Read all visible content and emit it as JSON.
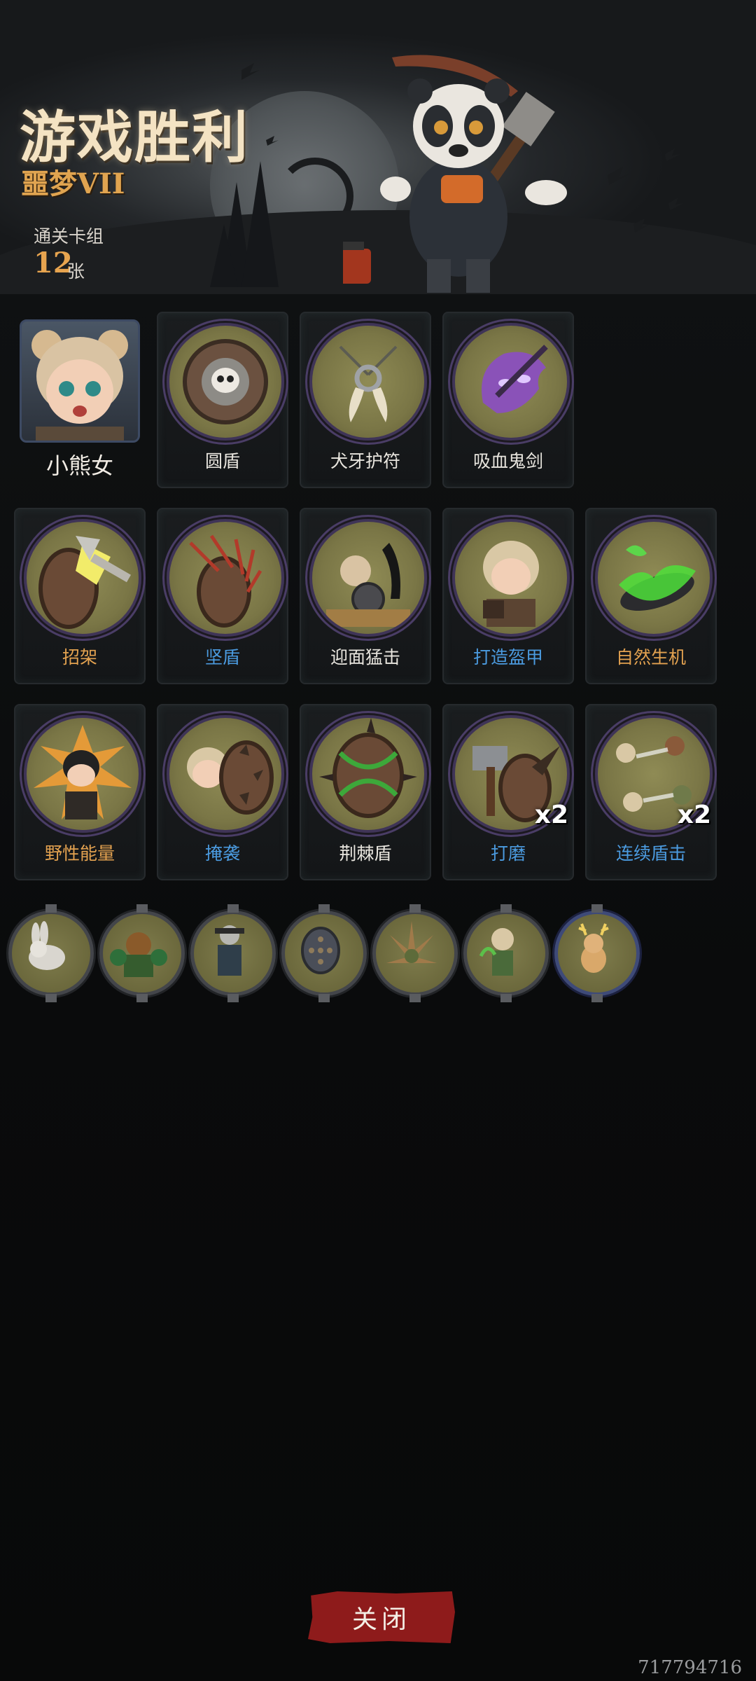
{
  "header": {
    "title": "游戏胜利",
    "difficulty": "噩梦VII",
    "deck_label": "通关卡组",
    "deck_count": "12",
    "deck_unit": "张"
  },
  "hero": {
    "name": "小熊女",
    "icon": "bear-girl-portrait-icon"
  },
  "equipment": [
    {
      "label": "圆盾",
      "icon": "skull-round-shield-icon",
      "color": "white"
    },
    {
      "label": "犬牙护符",
      "icon": "fang-amulet-icon",
      "color": "white"
    },
    {
      "label": "吸血鬼剑",
      "icon": "vampire-sword-icon",
      "color": "white"
    }
  ],
  "cards_row1": [
    {
      "label": "招架",
      "icon": "parry-axe-icon",
      "color": "orange"
    },
    {
      "label": "坚盾",
      "icon": "shield-arrows-icon",
      "color": "blue"
    },
    {
      "label": "迎面猛击",
      "icon": "head-on-strike-icon",
      "color": "white"
    },
    {
      "label": "打造盔甲",
      "icon": "forge-armor-icon",
      "color": "blue"
    },
    {
      "label": "自然生机",
      "icon": "nature-vitality-icon",
      "color": "orange"
    }
  ],
  "cards_row2": [
    {
      "label": "野性能量",
      "icon": "wild-energy-icon",
      "color": "orange"
    },
    {
      "label": "掩袭",
      "icon": "ambush-icon",
      "color": "blue"
    },
    {
      "label": "荆棘盾",
      "icon": "thorn-shield-icon",
      "color": "white"
    },
    {
      "label": "打磨",
      "icon": "polish-hammer-icon",
      "color": "blue",
      "multiplier": "x2"
    },
    {
      "label": "连续盾击",
      "icon": "combo-shield-bash-icon",
      "color": "blue",
      "multiplier": "x2"
    }
  ],
  "trinkets": [
    {
      "icon": "rabbit-icon",
      "frame": "gray"
    },
    {
      "icon": "bear-warrior-icon",
      "frame": "gray"
    },
    {
      "icon": "masked-rogue-icon",
      "frame": "gray"
    },
    {
      "icon": "spiked-shield-icon",
      "frame": "gray"
    },
    {
      "icon": "thorn-burst-icon",
      "frame": "gray"
    },
    {
      "icon": "forest-girl-icon",
      "frame": "gray"
    },
    {
      "icon": "deer-icon",
      "frame": "blue"
    }
  ],
  "close_button": {
    "label": "关闭"
  },
  "watermark": "717794716",
  "colors": {
    "title": "#f4e3c3",
    "difficulty": "#e0a450",
    "orange_label": "#e3a250",
    "blue_label": "#4b9be0",
    "close_button": "#8e1b1b"
  }
}
